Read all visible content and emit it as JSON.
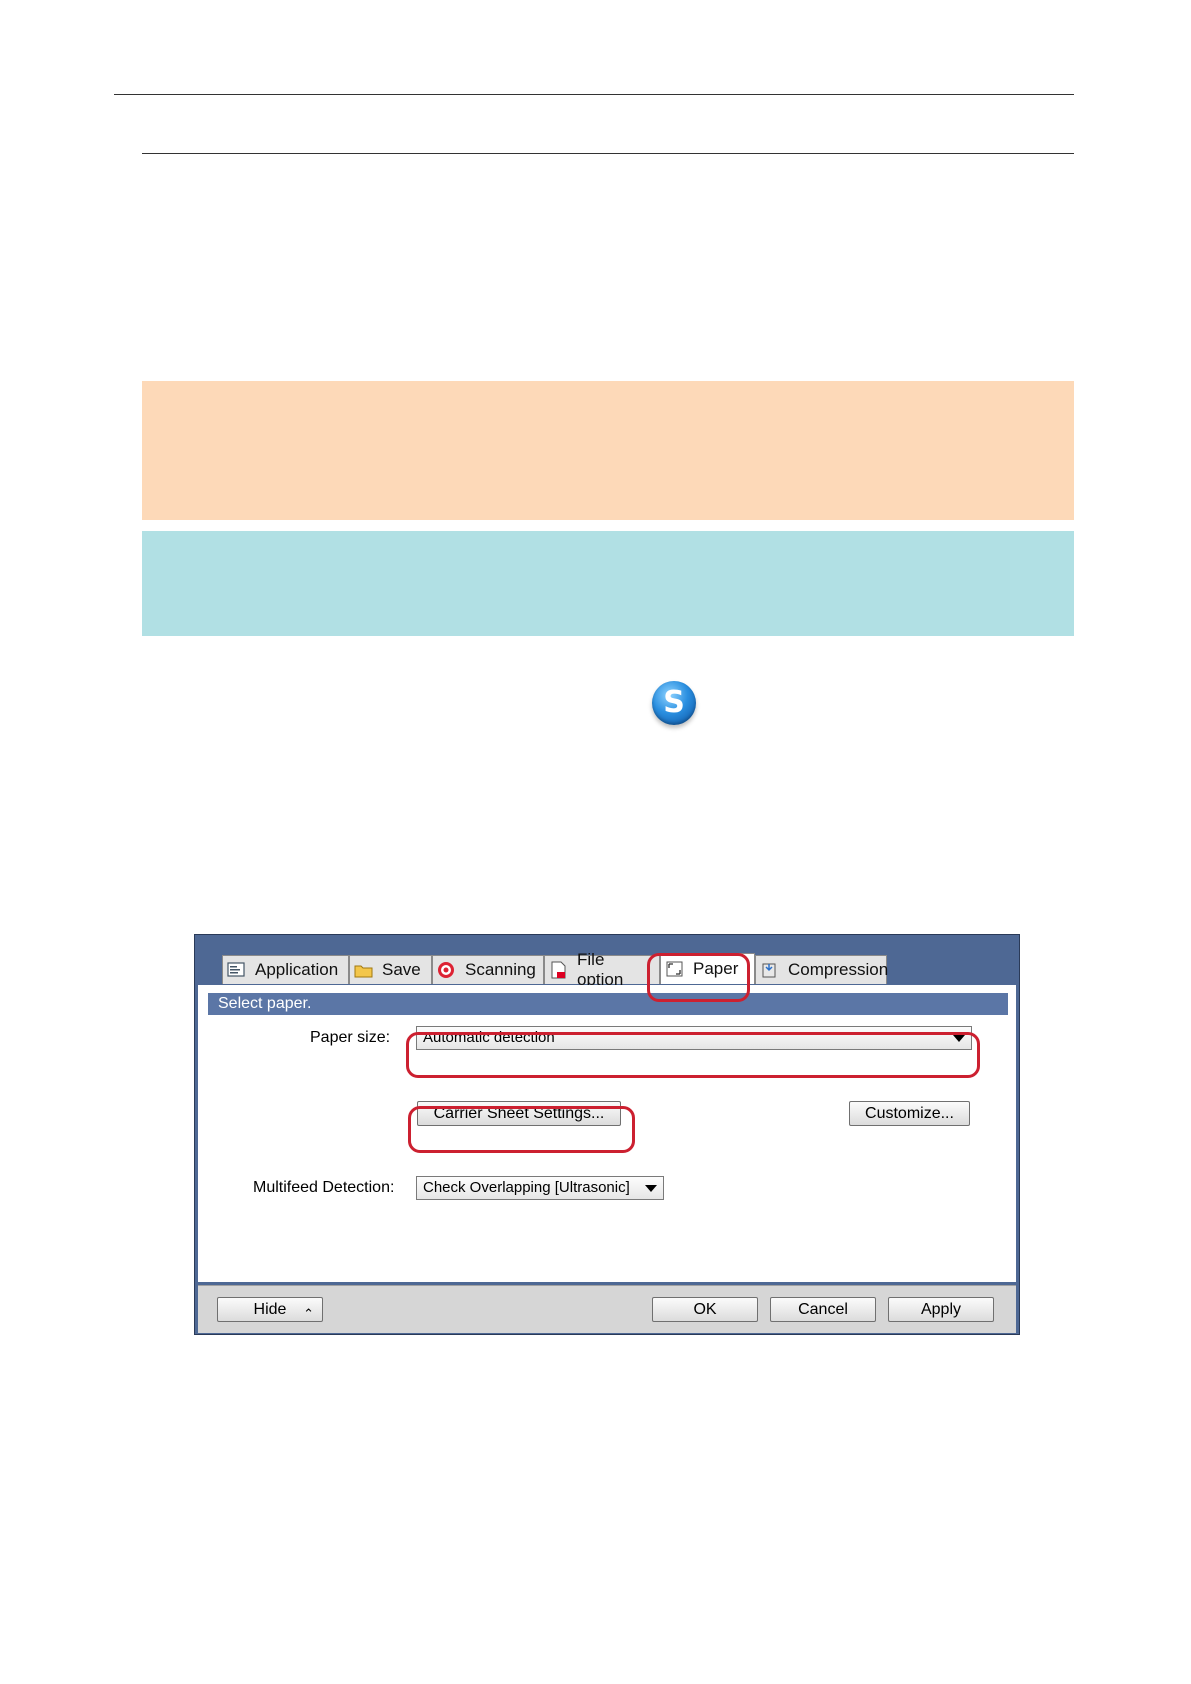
{
  "dialog": {
    "tabs": [
      {
        "label": "Application",
        "icon": "application-icon"
      },
      {
        "label": "Save",
        "icon": "folder-icon"
      },
      {
        "label": "Scanning",
        "icon": "scanning-icon"
      },
      {
        "label": "File option",
        "icon": "file-icon"
      },
      {
        "label": "Paper",
        "icon": "paper-icon"
      },
      {
        "label": "Compression",
        "icon": "compression-icon"
      }
    ],
    "section_title": "Select paper.",
    "paper_size_label": "Paper size:",
    "paper_size_value": "Automatic detection",
    "carrier_sheet_button": "Carrier Sheet Settings...",
    "customize_button": "Customize...",
    "multifeed_label": "Multifeed Detection:",
    "multifeed_value": "Check Overlapping [Ultrasonic]",
    "hide_button": "Hide",
    "ok_button": "OK",
    "cancel_button": "Cancel",
    "apply_button": "Apply"
  },
  "colors": {
    "note_orange": "#fdd9b8",
    "note_blue": "#b1e0e4",
    "highlight_red": "#cc2030",
    "dialog_frame": "#4e6894"
  }
}
